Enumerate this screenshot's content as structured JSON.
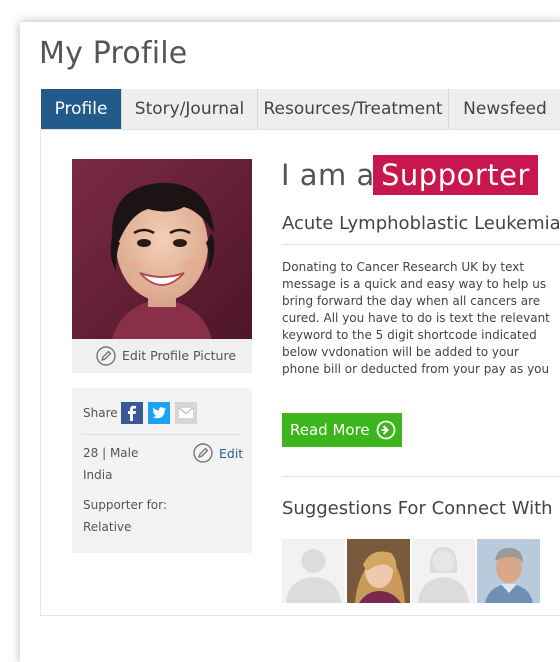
{
  "page": {
    "title": "My Profile"
  },
  "tabs": [
    {
      "label": "Profile",
      "active": true
    },
    {
      "label": "Story/Journal",
      "active": false
    },
    {
      "label": "Resources/Treatment",
      "active": false
    },
    {
      "label": "Newsfeed",
      "active": false
    }
  ],
  "profile": {
    "edit_picture_label": "Edit Profile Picture",
    "share_label": "Share",
    "share_icons": [
      "facebook-icon",
      "twitter-icon",
      "email-icon"
    ],
    "age_gender": "28 | Male",
    "country": "India",
    "edit_label": "Edit",
    "supporter_for_label": "Supporter for:",
    "relation": "Relative"
  },
  "main": {
    "role_prefix": "I am a",
    "role": "Supporter",
    "condition": "Acute Lymphoblastic Leukemia",
    "description_lines": [
      "Donating to Cancer Research UK by text",
      "message is a quick and easy way to help us",
      "bring forward the day when all cancers are",
      "cured. All you have to do is text the relevant",
      "keyword to the 5 digit shortcode indicated",
      "below vvdonation will be added to your",
      "phone bill or deducted from your pay as you"
    ],
    "read_more_label": "Read More",
    "suggestions_title": "Suggestions For Connect With"
  },
  "suggestions": [
    {
      "kind": "placeholder-male"
    },
    {
      "kind": "photo-woman"
    },
    {
      "kind": "placeholder-female"
    },
    {
      "kind": "photo-man"
    }
  ],
  "colors": {
    "tab_active": "#235a8c",
    "role_badge": "#c8164f",
    "read_more": "#3db51d",
    "link": "#2b5e8f",
    "facebook": "#3b5998",
    "twitter": "#1da1f2"
  }
}
